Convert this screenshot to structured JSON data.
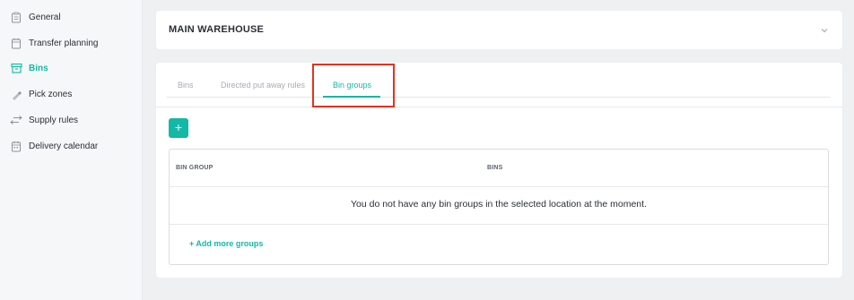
{
  "sidebar": {
    "items": [
      {
        "label": "General",
        "icon": "clipboard-icon",
        "active": false
      },
      {
        "label": "Transfer planning",
        "icon": "calendar-clipboard-icon",
        "active": false
      },
      {
        "label": "Bins",
        "icon": "bin-icon",
        "active": true
      },
      {
        "label": "Pick zones",
        "icon": "pick-tool-icon",
        "active": false
      },
      {
        "label": "Supply rules",
        "icon": "transfer-arrows-icon",
        "active": false
      },
      {
        "label": "Delivery calendar",
        "icon": "calendar-icon",
        "active": false
      }
    ]
  },
  "warehouse": {
    "title": "MAIN WAREHOUSE"
  },
  "tabs": [
    {
      "label": "Bins",
      "active": false
    },
    {
      "label": "Directed put away rules",
      "active": false
    },
    {
      "label": "Bin groups",
      "active": true
    }
  ],
  "add_button_label": "+",
  "table": {
    "columns": [
      "BIN GROUP",
      "BINS"
    ],
    "empty_message": "You do not have any bin groups in the selected location at the moment.",
    "add_more_label": "+ Add more groups"
  },
  "colors": {
    "accent": "#13b8a6",
    "highlight": "#e4321c"
  }
}
